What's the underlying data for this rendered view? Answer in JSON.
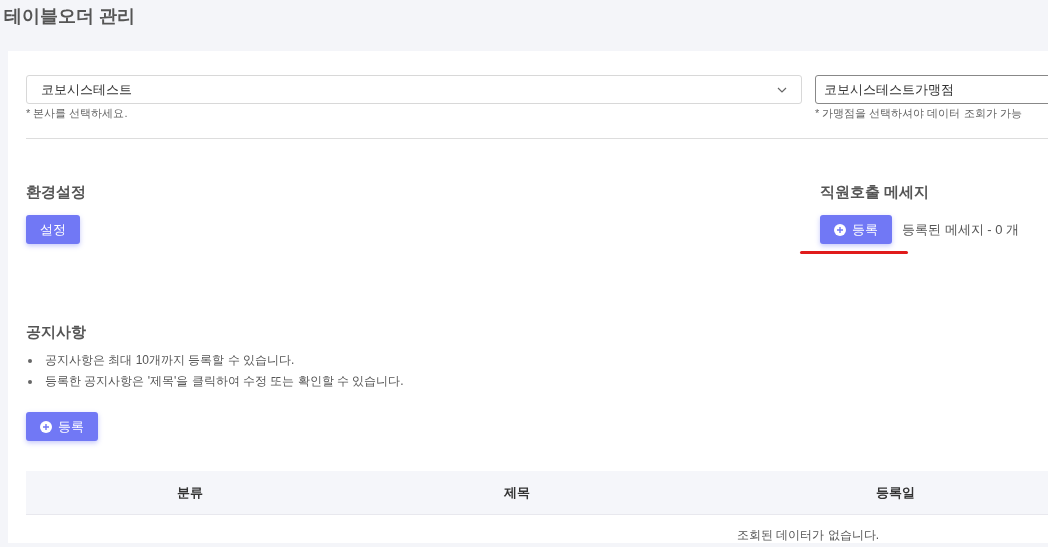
{
  "page_title": "테이블오더 관리",
  "headquarters_select": {
    "value": "코보시스테스트",
    "hint": "* 본사를 선택하세요."
  },
  "store_select": {
    "value": "코보시스테스트가맹점",
    "hint": "* 가맹점을 선택하셔야 데이터 조회가 가능"
  },
  "settings_section": {
    "title": "환경설정",
    "button": "설정"
  },
  "staff_call_section": {
    "title": "직원호출 메세지",
    "button": "등록",
    "count_text": "등록된 메세지 - 0 개",
    "highlighted": true
  },
  "notice_section": {
    "title": "공지사항",
    "bullets": [
      "공지사항은 최대 10개까지 등록할 수 있습니다.",
      "등록한 공지사항은 '제목'을 클릭하여 수정 또는 확인할 수 있습니다."
    ],
    "button": "등록"
  },
  "table": {
    "columns": [
      "분류",
      "제목",
      "등록일"
    ],
    "empty_message": "조회된 데이터가 없습니다."
  }
}
